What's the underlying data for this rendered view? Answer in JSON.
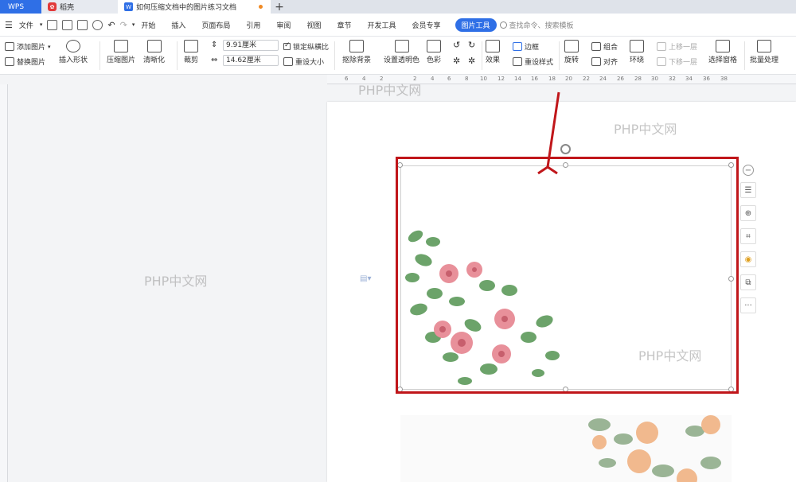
{
  "tabs": {
    "wps": "WPS",
    "daoke": "稻壳",
    "doc_title": "如何压缩文档中的图片练习文档",
    "new_tab": "+"
  },
  "menu": {
    "file": "文件",
    "items": [
      "开始",
      "插入",
      "页面布局",
      "引用",
      "审阅",
      "视图",
      "章节",
      "开发工具",
      "会员专享"
    ],
    "picture_tools": "图片工具",
    "search_placeholder": "查找命令、搜索模板"
  },
  "ribbon": {
    "add_picture": "添加图片",
    "replace_picture": "替换图片",
    "insert_shape": "插入形状",
    "compress_picture": "压缩图片",
    "sharpen": "清晰化",
    "crop": "裁剪",
    "height_value": "9.91厘米",
    "width_value": "14.62厘米",
    "lock_ratio": "锁定纵横比",
    "reset_size": "重设大小",
    "remove_background": "抠除背景",
    "set_transparent": "设置透明色",
    "color": "色彩",
    "effects": "效果",
    "border": "边框",
    "reset_style": "重设样式",
    "rotate": "旋转",
    "group": "组合",
    "align": "对齐",
    "wrap": "环绕",
    "bring_forward": "上移一层",
    "send_backward": "下移一层",
    "selection_pane": "选择窗格",
    "batch_process": "批量处理"
  },
  "ruler": [
    "6",
    "4",
    "2",
    "2",
    "4",
    "6",
    "8",
    "10",
    "12",
    "14",
    "16",
    "18",
    "20",
    "22",
    "24",
    "26",
    "28",
    "30",
    "32",
    "34",
    "36",
    "38"
  ],
  "watermark": "PHP中文网",
  "side_toolbar": {
    "more": "···"
  },
  "colors": {
    "wps_blue": "#2f6fe6",
    "selection_red": "#c0161a",
    "leaf_green": "#5d9a5a",
    "rose_pink": "#e8909a"
  }
}
